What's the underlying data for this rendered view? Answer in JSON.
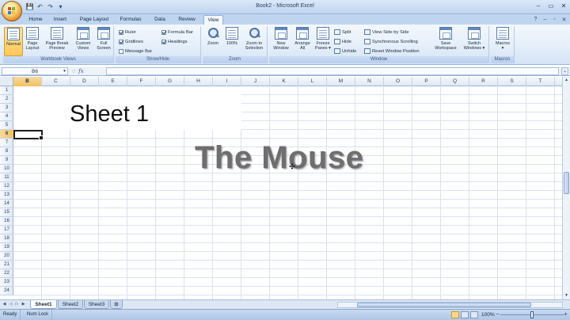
{
  "window": {
    "title": "Book2 - Microsoft Excel",
    "controls": {
      "minimize": "–",
      "maximize": "▭",
      "close": "✕"
    }
  },
  "ribbon_tabs": [
    "Home",
    "Insert",
    "Page Layout",
    "Formulas",
    "Data",
    "Review",
    "View"
  ],
  "active_tab": "View",
  "ribbon": {
    "workbook_views": {
      "label": "Workbook Views",
      "buttons": [
        {
          "line1": "Normal",
          "line2": ""
        },
        {
          "line1": "Page",
          "line2": "Layout"
        },
        {
          "line1": "Page Break",
          "line2": "Preview"
        },
        {
          "line1": "Custom",
          "line2": "Views"
        },
        {
          "line1": "Full",
          "line2": "Screen"
        }
      ]
    },
    "show_hide": {
      "label": "Show/Hide",
      "items": [
        {
          "text": "Ruler",
          "checked": true
        },
        {
          "text": "Gridlines",
          "checked": true
        },
        {
          "text": "Message Bar",
          "checked": false
        },
        {
          "text": "Formula Bar",
          "checked": true
        },
        {
          "text": "Headings",
          "checked": true
        }
      ]
    },
    "zoom": {
      "label": "Zoom",
      "buttons": [
        {
          "line1": "Zoom",
          "line2": ""
        },
        {
          "line1": "100%",
          "line2": ""
        },
        {
          "line1": "Zoom to",
          "line2": "Selection"
        }
      ]
    },
    "window": {
      "label": "Window",
      "buttons": [
        {
          "line1": "New",
          "line2": "Window"
        },
        {
          "line1": "Arrange",
          "line2": "All"
        },
        {
          "line1": "Freeze",
          "line2": "Panes ▾"
        }
      ],
      "small": [
        "Split",
        "Hide",
        "Unhide"
      ],
      "side": [
        "View Side by Side",
        "Synchronous Scrolling",
        "Reset Window Position"
      ],
      "buttons2": [
        {
          "line1": "Save",
          "line2": "Workspace"
        },
        {
          "line1": "Switch",
          "line2": "Windows ▾"
        }
      ]
    },
    "macros": {
      "label": "Macros",
      "button": "Macros"
    }
  },
  "formula_bar": {
    "name_box": "B6",
    "fx": "fx",
    "value": ""
  },
  "grid": {
    "columns": [
      "B",
      "C",
      "D",
      "E",
      "F",
      "G",
      "H",
      "I",
      "J",
      "K",
      "L",
      "M",
      "N",
      "O",
      "P",
      "Q",
      "R",
      "S",
      "T"
    ],
    "selected_column": "B",
    "rows": [
      "1",
      "2",
      "3",
      "4",
      "5",
      "6",
      "7",
      "8",
      "9",
      "10",
      "11",
      "12",
      "13",
      "14",
      "15",
      "16",
      "17",
      "18",
      "19",
      "20",
      "21",
      "22",
      "23",
      "24"
    ],
    "selected_row": "6",
    "sheet_text": "Sheet 1",
    "overlay_text": "The Mouse"
  },
  "sheet_tabs": [
    "Sheet1",
    "Sheet2",
    "Sheet3"
  ],
  "active_sheet": "Sheet1",
  "status_bar": {
    "mode": "Ready",
    "num_lock": "Num Lock",
    "zoom": "100%"
  },
  "colors": {
    "ribbon_top": "#f4f8fd",
    "tab_bar": "#bfd4ef",
    "selected_header": "#f1c15f",
    "overlay_text": "#6e6e6e"
  }
}
